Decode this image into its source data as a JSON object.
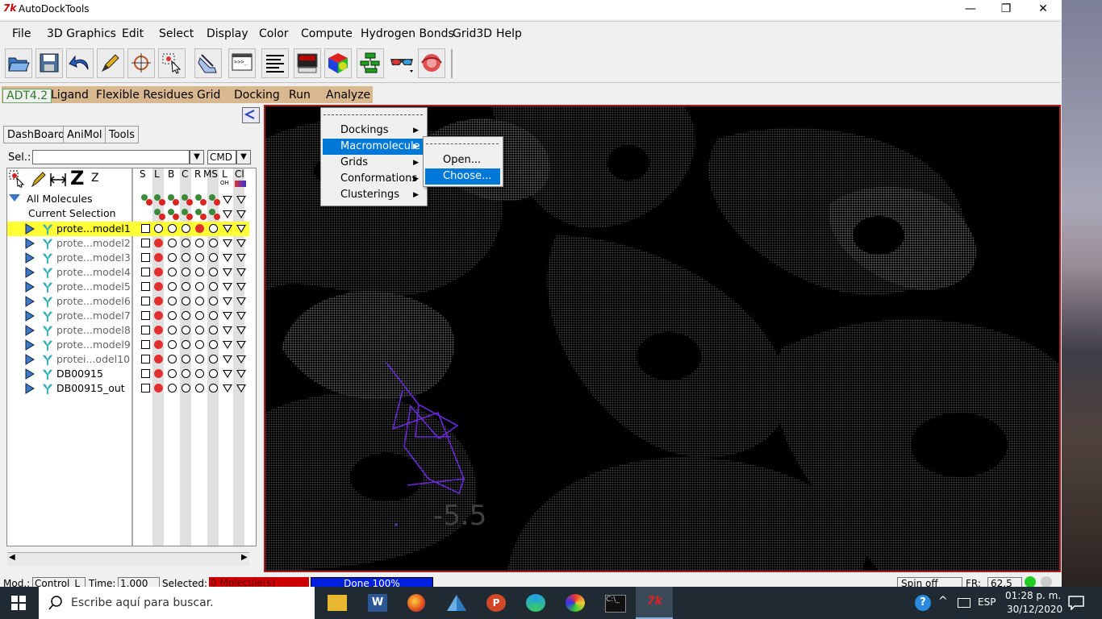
{
  "window": {
    "title": "AutoDockTools",
    "minimize": "—",
    "restore": "❐",
    "close": "✕"
  },
  "menubar": [
    "File",
    "3D Graphics",
    "Edit",
    "Select",
    "Display",
    "Color",
    "Compute",
    "Hydrogen Bonds",
    "Grid3D",
    "Help"
  ],
  "toolbar_icons": [
    "open-folder-icon",
    "save-icon",
    "undo-arrow-icon",
    "pencil-icon",
    "crosshair-icon",
    "select-icon",
    "hand-icon",
    "python-shell-icon",
    "text-lines-icon",
    "monitor-icon",
    "color-cube-icon",
    "network-icon",
    "3d-glasses-icon",
    "flame-icon"
  ],
  "adt_menubar": [
    "ADT4.2",
    "Ligand",
    "Flexible Residues",
    "Grid",
    "Docking",
    "Run",
    "Analyze"
  ],
  "left_panel": {
    "tabs": [
      "DashBoard",
      "AniMol",
      "Tools"
    ],
    "sel_label": "Sel.:",
    "sel_value": "",
    "cmd_label": "CMD",
    "zoom_label": "Z",
    "column_headers": [
      "S",
      "L",
      "B",
      "C",
      "R",
      "MS",
      "L",
      "Cl"
    ],
    "header_icon_text": "OH",
    "tree": {
      "all_molecules": "All Molecules",
      "current_selection": "Current Selection",
      "molecules": [
        "prote...model1",
        "prote...model2",
        "prote...model3",
        "prote...model4",
        "prote...model5",
        "prote...model6",
        "prote...model7",
        "prote...model8",
        "prote...model9",
        "protei...odel10",
        "DB00915",
        "DB00915_out"
      ]
    }
  },
  "viewer": {
    "label": "-5.5"
  },
  "analyze_menu": {
    "items": [
      "Dockings",
      "Macromolecule",
      "Grids",
      "Conformations",
      "Clusterings"
    ],
    "highlighted": "Macromolecule"
  },
  "macromolecule_submenu": {
    "items": [
      "Open...",
      "Choose..."
    ],
    "highlighted": "Choose..."
  },
  "statusbar": {
    "mod_label": "Mod.:",
    "mod_value": "Control_L",
    "time_label": "Time:",
    "time_value": "1.000",
    "selected_label": "Selected:",
    "selected_value": "0 Molecule(s)",
    "progress_text": "Done 100%",
    "spin": "Spin off",
    "fr_label": "FR:",
    "fr_value": "62.5"
  },
  "taskbar": {
    "search_placeholder": "Escribe aquí para buscar.",
    "language": "ESP",
    "time": "01:28 p. m.",
    "date": "30/12/2020"
  },
  "colors": {
    "highlight": "#0078d7",
    "selected_row": "#ffff33",
    "viewer_border": "#b01a1a",
    "adt_tab": "#d9b890"
  }
}
